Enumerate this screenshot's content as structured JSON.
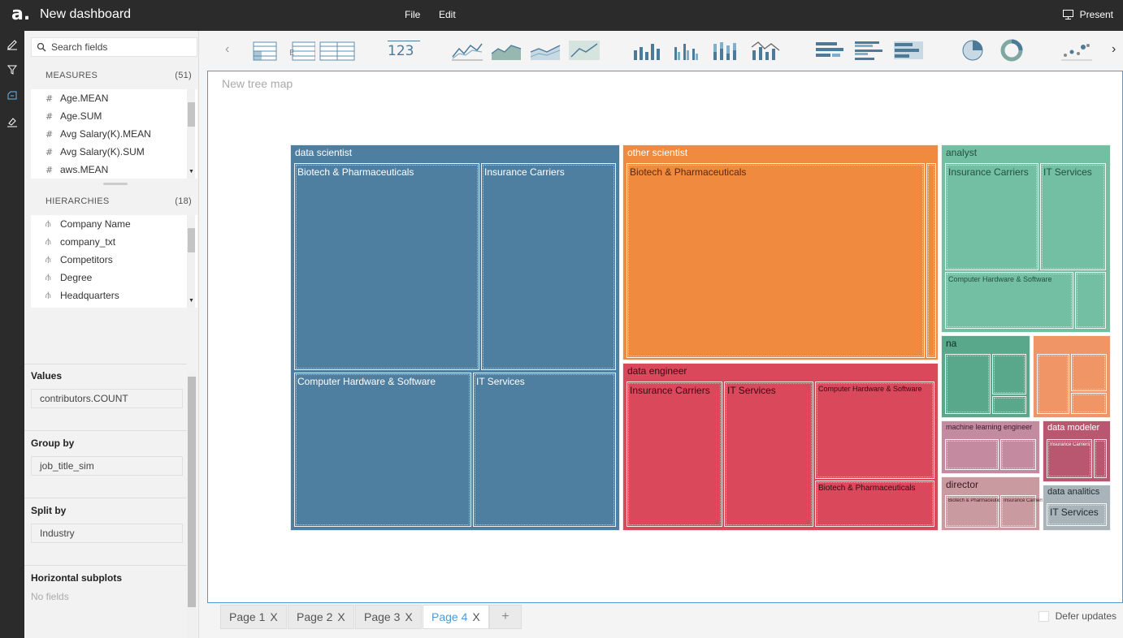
{
  "app": {
    "logo": "a.",
    "title": "New dashboard"
  },
  "menu": {
    "file": "File",
    "edit": "Edit",
    "present": "Present"
  },
  "search": {
    "placeholder": "Search fields"
  },
  "measures": {
    "title": "MEASURES",
    "count": "(51)",
    "items": [
      "Age.MEAN",
      "Age.SUM",
      "Avg Salary(K).MEAN",
      "Avg Salary(K).SUM",
      "aws.MEAN"
    ]
  },
  "hierarchies": {
    "title": "HIERARCHIES",
    "count": "(18)",
    "items": [
      "Company Name",
      "company_txt",
      "Competitors",
      "Degree",
      "Headquarters"
    ]
  },
  "panels": {
    "values_label": "Values",
    "values_field": "contributors.COUNT",
    "groupby_label": "Group by",
    "groupby_field": "job_title_sim",
    "splitby_label": "Split by",
    "splitby_field": "Industry",
    "hsub_label": "Horizontal subplots",
    "hsub_empty": "No fields"
  },
  "toolbar": {
    "kpi_label": "123"
  },
  "canvas": {
    "title": "New tree map"
  },
  "treemap": {
    "colors": {
      "data_scientist": "#4e7fa1",
      "other_scientist": "#ef8a3e",
      "data_engineer": "#d9485b",
      "analyst": "#72bfa3",
      "na": "#5aa88b",
      "unlabeled_orange": "#ef9566",
      "ml_engineer": "#c48aa0",
      "data_modeler": "#b95670",
      "director": "#c99a9f",
      "data_analitics": "#a9b4ba"
    },
    "groups": {
      "data_scientist": "data scientist",
      "other_scientist": "other scientist",
      "data_engineer": "data engineer",
      "analyst": "analyst",
      "na": "na",
      "ml_engineer": "machine learning engineer",
      "data_modeler": "data modeler",
      "director": "director",
      "data_analitics": "data analitics"
    },
    "cells": {
      "ds_biotech": "Biotech & Pharmaceuticals",
      "ds_insurance": "Insurance Carriers",
      "ds_hardware": "Computer Hardware & Software",
      "ds_it": "IT Services",
      "os_biotech": "Biotech & Pharmaceuticals",
      "de_insurance": "Insurance Carriers",
      "de_it": "IT Services",
      "de_hardware": "Computer Hardware & Software",
      "de_biotech": "Biotech & Pharmaceuticals",
      "an_insurance": "Insurance Carriers",
      "an_it": "IT Services",
      "an_hardware": "Computer Hardware & Software",
      "dm_insurance": "Insurance Carriers",
      "dir_biotech": "Biotech & Pharmaceuticals",
      "dir_insurance": "Insurance Carriers",
      "da_it": "IT Services"
    }
  },
  "tabs": [
    {
      "label": "Page 1",
      "active": false
    },
    {
      "label": "Page 2",
      "active": false
    },
    {
      "label": "Page 3",
      "active": false
    },
    {
      "label": "Page 4",
      "active": true
    }
  ],
  "tab_close_glyph": "X",
  "add_tab": "+",
  "defer": {
    "label": "Defer updates"
  }
}
